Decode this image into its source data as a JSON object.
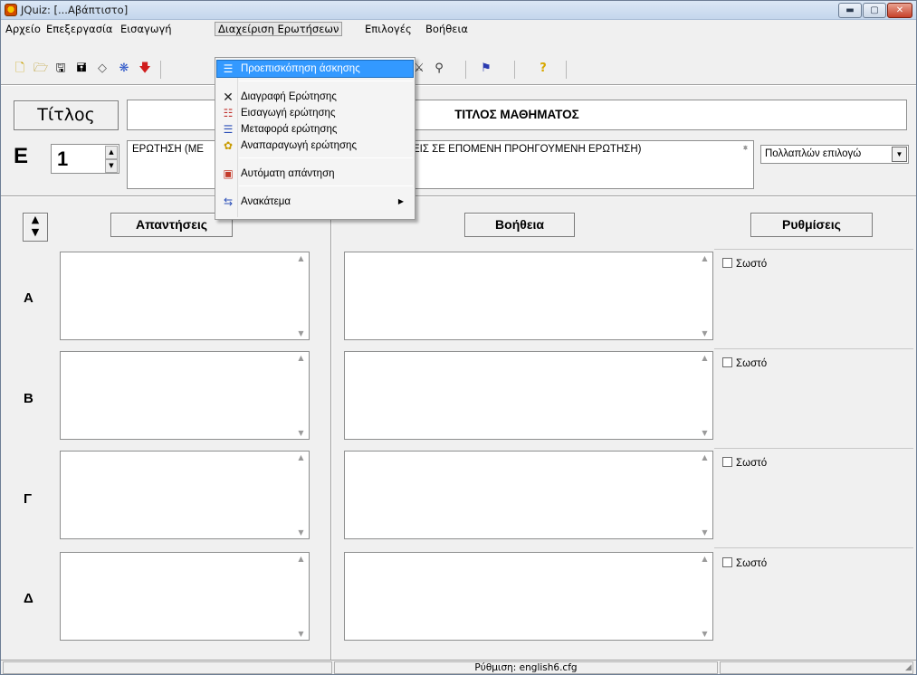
{
  "window": {
    "title": "JQuiz: [...Αβάπτιστο]",
    "controls": {
      "minimize": "▬",
      "maximize": "▢",
      "close": "✕"
    }
  },
  "menubar": {
    "items": [
      "Αρχείο",
      "Επεξεργασία",
      "Εισαγωγή",
      "Διαχείριση Ερωτήσεων",
      "Επιλογές",
      "Βοήθεια"
    ],
    "open_index": 3
  },
  "toolbar": {
    "icons": [
      "new-file-icon",
      "open-folder-icon",
      "save-icon",
      "save-as-icon",
      "eraser-icon",
      "web-export-icon",
      "download-arrow-icon",
      "list-icon",
      "replace-icon",
      "find-icon",
      "flag-icon",
      "help-icon"
    ]
  },
  "dropdown": {
    "items": [
      {
        "label": "Προεπισκόπηση άσκησης",
        "icon": "list-icon",
        "highlighted": true
      },
      {
        "label": "Διαγραφή Ερώτησης",
        "icon": "delete-x-icon"
      },
      {
        "label": "Εισαγωγή ερώτησης",
        "icon": "insert-question-icon"
      },
      {
        "label": "Μεταφορά ερώτησης",
        "icon": "move-question-icon"
      },
      {
        "label": "Αναπαραγωγή ερώτησης",
        "icon": "duplicate-question-icon"
      },
      {
        "label": "Αυτόματη απάντηση",
        "icon": "auto-answer-icon"
      },
      {
        "label": "Ανακάτεμα",
        "icon": "shuffle-icon",
        "submenu": true
      }
    ]
  },
  "main": {
    "title_button": "Τίτλος",
    "title_value": "ΤΙΤΛΟΣ ΜΑΘΗΜΑΤΟΣ",
    "question_label": "E",
    "question_number": "1",
    "question_text_left": "ΕΡΩΤΗΣΗ (ΜΕ",
    "question_text_right": "ΕΙΣ ΣΕ ΕΠΟΜΕΝΗ ΠΡΟΗΓΟΥΜΕΝΗ ΕΡΩΤΗΣΗ)",
    "question_type": "Πολλαπλών επιλογώ"
  },
  "headers": {
    "answers": "Απαντήσεις",
    "help": "Βοήθεια",
    "settings": "Ρυθμίσεις"
  },
  "answers": [
    {
      "letter": "A",
      "correct_label": "Σωστό",
      "checked": false
    },
    {
      "letter": "B",
      "correct_label": "Σωστό",
      "checked": false
    },
    {
      "letter": "Γ",
      "correct_label": "Σωστό",
      "checked": false
    },
    {
      "letter": "Δ",
      "correct_label": "Σωστό",
      "checked": false
    }
  ],
  "statusbar": {
    "config": "Ρύθμιση: english6.cfg"
  }
}
